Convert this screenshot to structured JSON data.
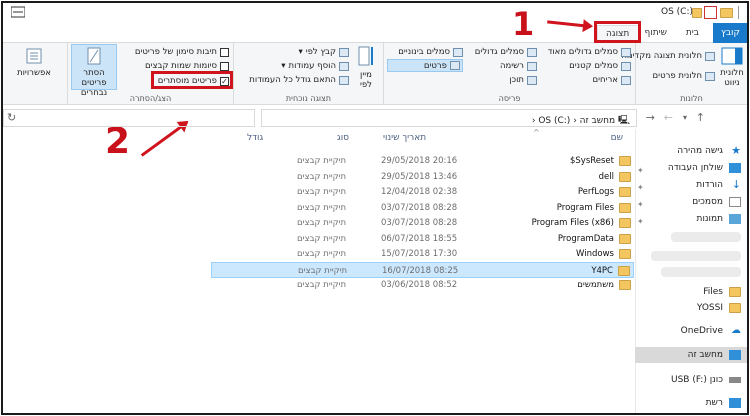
{
  "window": {
    "title": "OS (C:)"
  },
  "tabs": {
    "file": "קובץ",
    "home": "בית",
    "share": "שיתוף",
    "view": "תצוגה"
  },
  "annotations": {
    "step1": "1",
    "step2": "2"
  },
  "colors": {
    "accent": "#1979ca",
    "highlight": "#d0141e",
    "selection": "#cce8ff"
  },
  "ribbon": {
    "panes": {
      "label": "חלונות",
      "nav_pane": "חלונית ניווט",
      "preview_pane": "חלונית תצוגה מקדימה",
      "details_pane": "חלונית פרטים"
    },
    "layout": {
      "label": "פריסה",
      "extra_large": "סמלים גדולים מאוד",
      "large": "סמלים גדולים",
      "medium": "סמלים בינוניים",
      "small": "סמלים קטנים",
      "list": "רשימה",
      "details": "פרטים",
      "tiles": "אריחים",
      "content": "תוכן"
    },
    "current_view": {
      "label": "תצוגה נוכחית",
      "sort_by": "מיין לפי",
      "group_by": "קבץ לפי",
      "add_columns": "הוסף עמודות",
      "size_columns": "התאם גודל כל העמודות"
    },
    "show_hide": {
      "label": "הצג/הסתרה",
      "item_checkboxes": "תיבות סימון של פריטים",
      "file_extensions": "סיומות שמות קבצים",
      "hidden_items": "פריטים מוסתרים",
      "hide_selected": "הסתר פריטים נבחרים"
    },
    "options": "אפשרויות"
  },
  "address": {
    "path_root": "מחשב זה",
    "path_drive": "OS (C:)"
  },
  "columns": {
    "name": "שם",
    "modified": "תאריך שינוי",
    "type": "סוג",
    "size": "גודל"
  },
  "files": [
    {
      "name": "$SysReset",
      "date": "29/05/2018 20:16",
      "type": "תיקיית קבצים"
    },
    {
      "name": "dell",
      "date": "29/05/2018 13:46",
      "type": "תיקיית קבצים"
    },
    {
      "name": "PerfLogs",
      "date": "12/04/2018 02:38",
      "type": "תיקיית קבצים"
    },
    {
      "name": "Program Files",
      "date": "03/07/2018 08:28",
      "type": "תיקיית קבצים"
    },
    {
      "name": "Program Files (x86)",
      "date": "03/07/2018 08:28",
      "type": "תיקיית קבצים"
    },
    {
      "name": "ProgramData",
      "date": "06/07/2018 18:55",
      "type": "תיקיית קבצים"
    },
    {
      "name": "Windows",
      "date": "15/07/2018 17:30",
      "type": "תיקיית קבצים"
    },
    {
      "name": "Y4PC",
      "date": "16/07/2018 08:25",
      "type": "תיקיית קבצים"
    },
    {
      "name": "משתמשים",
      "date": "03/06/2018 08:52",
      "type": "תיקיית קבצים"
    }
  ],
  "nav": {
    "quick_access": "גישה מהירה",
    "desktop": "שולחן העבודה",
    "downloads": "הורדות",
    "documents": "מסמכים",
    "pictures": "תמונות",
    "files": "Files",
    "yossi": "YOSSI",
    "onedrive": "OneDrive",
    "this_pc": "מחשב זה",
    "usb": "USB (F:) כונן",
    "network": "רשת"
  }
}
